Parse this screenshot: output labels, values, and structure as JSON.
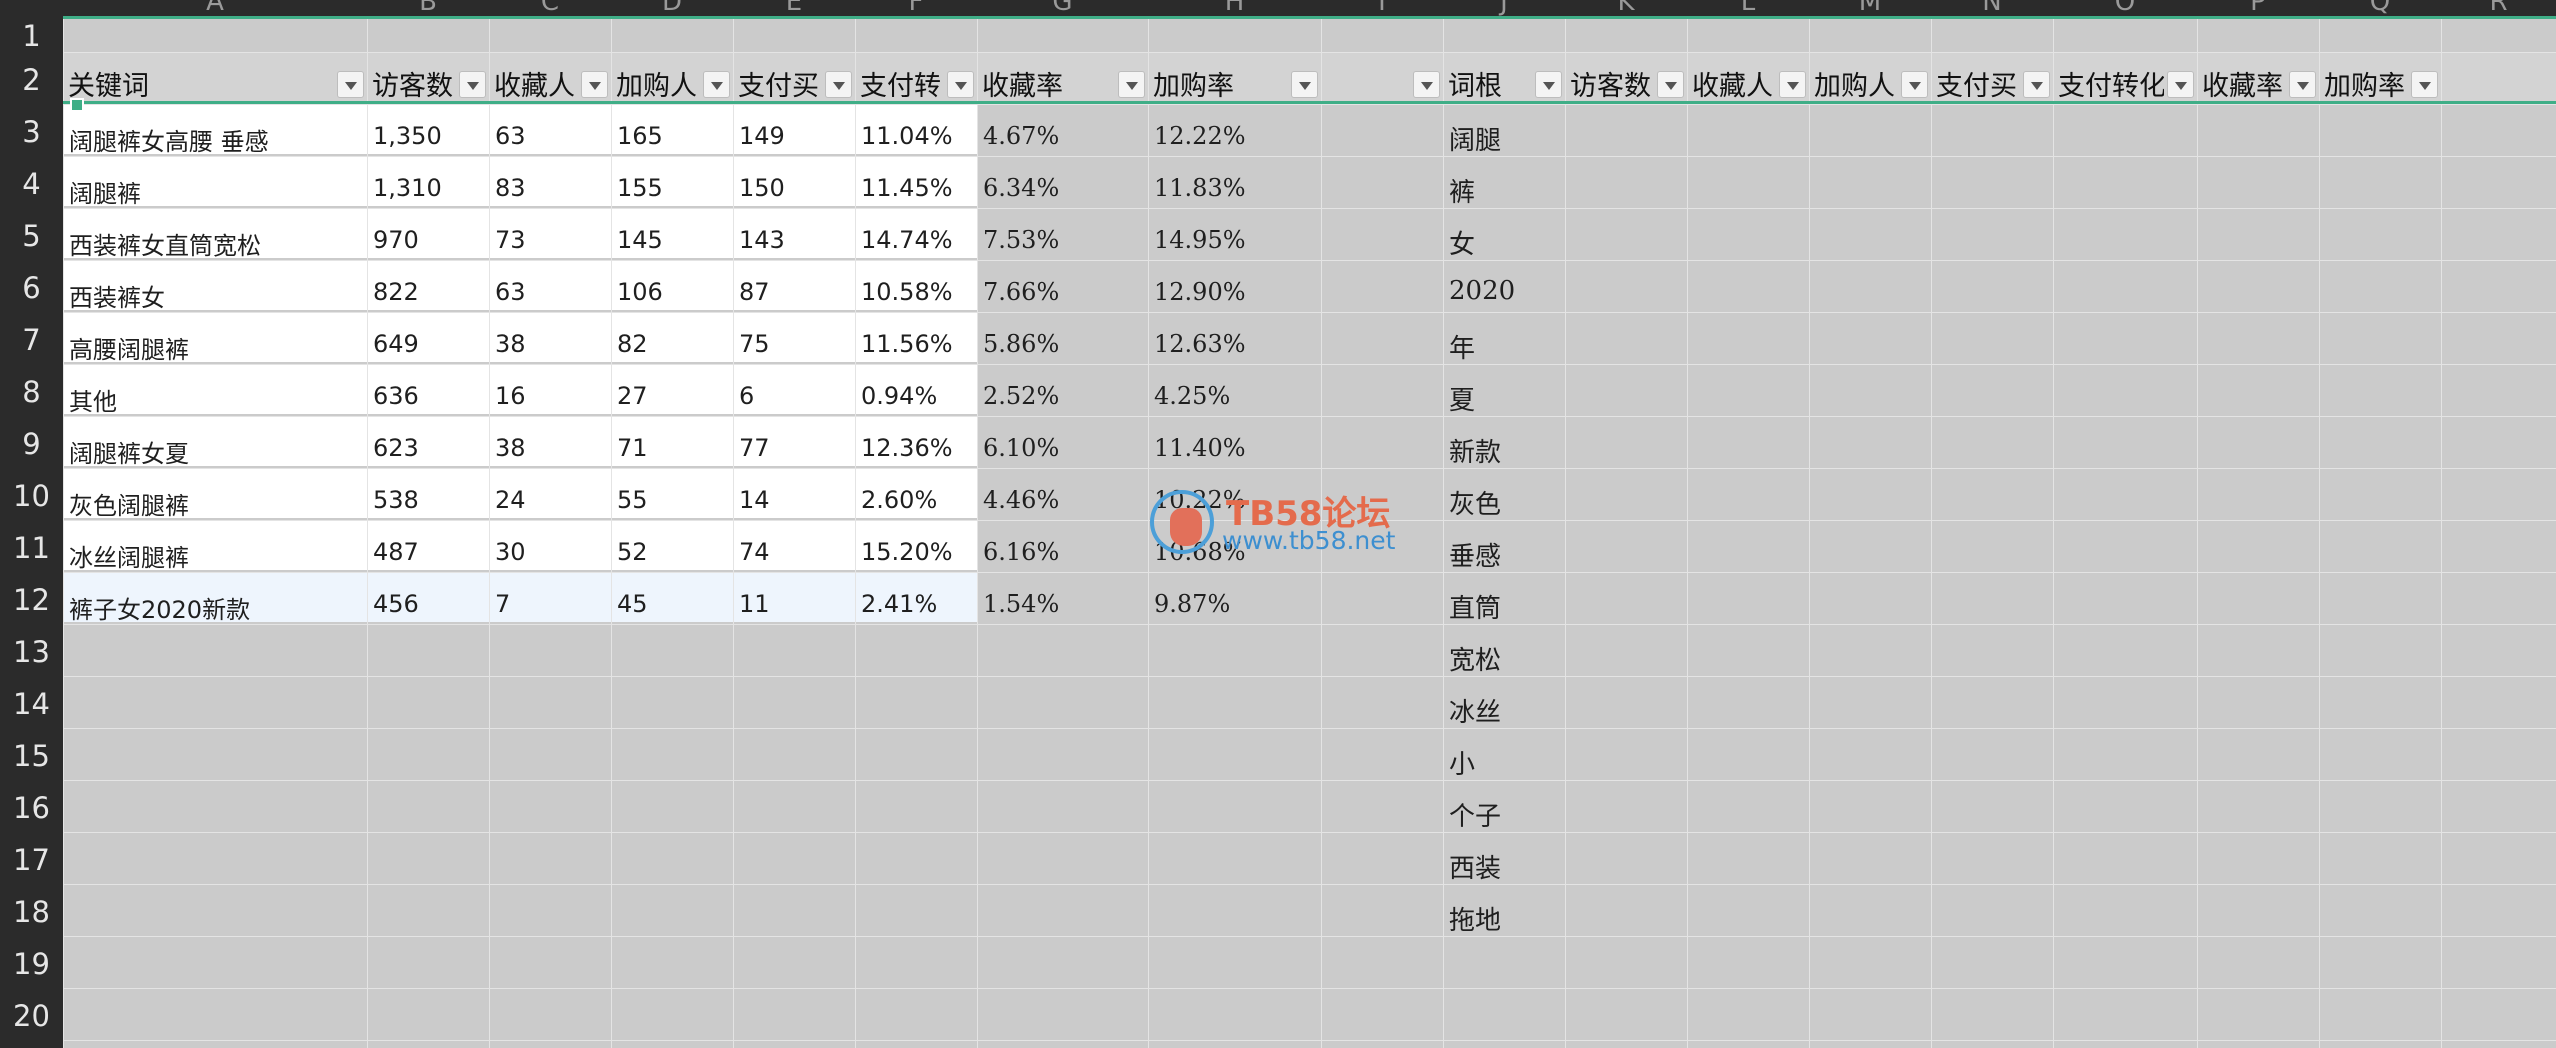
{
  "column_letters": [
    "A",
    "B",
    "C",
    "D",
    "E",
    "F",
    "G",
    "H",
    "I",
    "J",
    "K",
    "L",
    "M",
    "N",
    "O",
    "P",
    "Q",
    "R"
  ],
  "row_numbers": [
    "1",
    "2",
    "3",
    "4",
    "5",
    "6",
    "7",
    "8",
    "9",
    "10",
    "11",
    "12",
    "13",
    "14",
    "15",
    "16",
    "17",
    "18",
    "19",
    "20"
  ],
  "table_headers": [
    "关键词",
    "访客数",
    "收藏人",
    "加购人",
    "支付买",
    "支付转",
    "收藏率",
    "加购率",
    ""
  ],
  "keyword_rows": [
    [
      "阔腿裤女高腰 垂感",
      "1,350",
      "63",
      "165",
      "149",
      "11.04%",
      "4.67%",
      "12.22%"
    ],
    [
      "阔腿裤",
      "1,310",
      "83",
      "155",
      "150",
      "11.45%",
      "6.34%",
      "11.83%"
    ],
    [
      "西装裤女直筒宽松",
      "970",
      "73",
      "145",
      "143",
      "14.74%",
      "7.53%",
      "14.95%"
    ],
    [
      "西装裤女",
      "822",
      "63",
      "106",
      "87",
      "10.58%",
      "7.66%",
      "12.90%"
    ],
    [
      "高腰阔腿裤",
      "649",
      "38",
      "82",
      "75",
      "11.56%",
      "5.86%",
      "12.63%"
    ],
    [
      "其他",
      "636",
      "16",
      "27",
      "6",
      "0.94%",
      "2.52%",
      "4.25%"
    ],
    [
      "阔腿裤女夏",
      "623",
      "38",
      "71",
      "77",
      "12.36%",
      "6.10%",
      "11.40%"
    ],
    [
      "灰色阔腿裤",
      "538",
      "24",
      "55",
      "14",
      "2.60%",
      "4.46%",
      "10.22%"
    ],
    [
      "冰丝阔腿裤",
      "487",
      "30",
      "52",
      "74",
      "15.20%",
      "6.16%",
      "10.68%"
    ],
    [
      "裤子女2020新款",
      "456",
      "7",
      "45",
      "11",
      "2.41%",
      "1.54%",
      "9.87%"
    ]
  ],
  "root_headers": [
    "词根",
    "访客数",
    "收藏人",
    "加购人",
    "支付买",
    "支付转化",
    "收藏率",
    "加购率"
  ],
  "root_words": [
    "阔腿",
    "裤",
    "女",
    "2020",
    "年",
    "夏",
    "新款",
    "灰色",
    "垂感",
    "直筒",
    "宽松",
    "冰丝",
    "小",
    "个子",
    "西装",
    "拖地"
  ],
  "watermark": {
    "title": "TB58论坛",
    "url": "www.tb58.net"
  },
  "colors": {
    "accent": "#3fae87",
    "header_bg": "#2b2b2b",
    "sheet_bg": "#cbcbcb"
  }
}
